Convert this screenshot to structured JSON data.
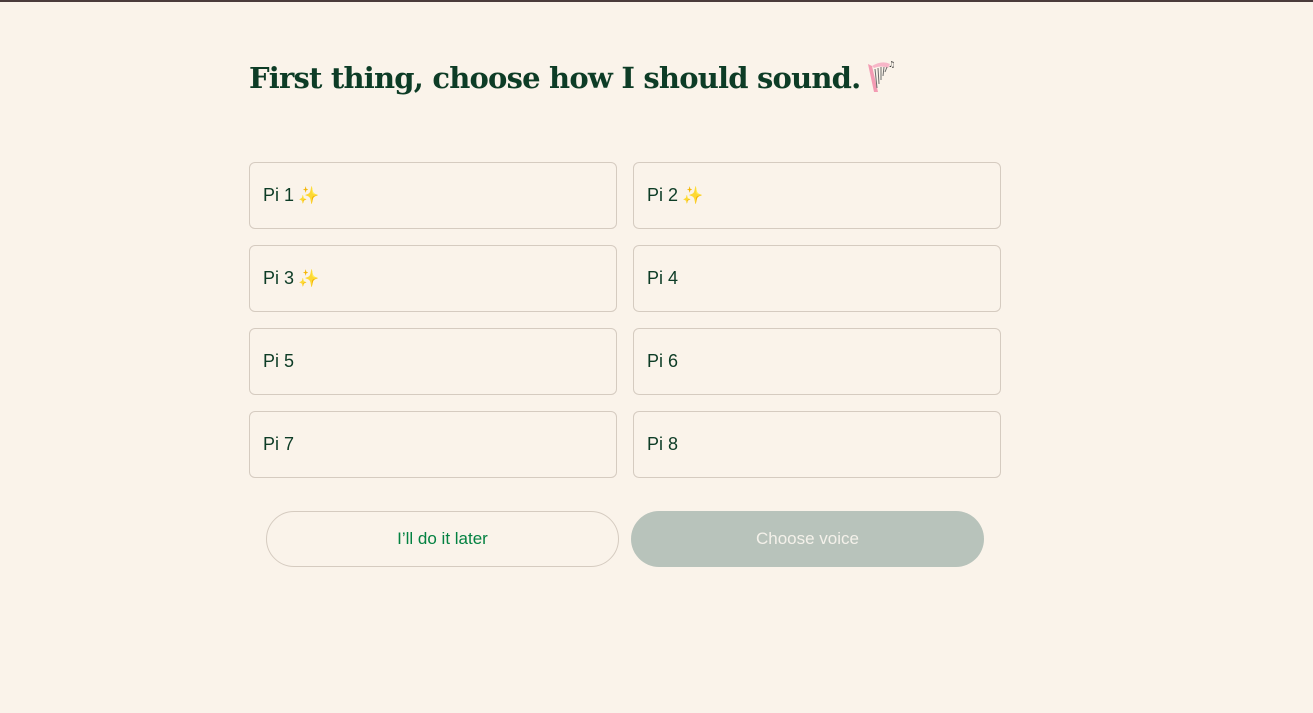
{
  "heading": {
    "text": "First thing, choose how I should sound.",
    "icon": "harp-icon"
  },
  "voices": [
    {
      "label": "Pi 1",
      "sparkle": "✨"
    },
    {
      "label": "Pi 2",
      "sparkle": "✨"
    },
    {
      "label": "Pi 3",
      "sparkle": "✨"
    },
    {
      "label": "Pi 4",
      "sparkle": ""
    },
    {
      "label": "Pi 5",
      "sparkle": ""
    },
    {
      "label": "Pi 6",
      "sparkle": ""
    },
    {
      "label": "Pi 7",
      "sparkle": ""
    },
    {
      "label": "Pi 8",
      "sparkle": ""
    }
  ],
  "actions": {
    "later_label": "I’ll do it later",
    "choose_label": "Choose voice"
  },
  "colors": {
    "background": "#faf3ea",
    "heading": "#0d3c26",
    "accent_green": "#038141",
    "disabled_button": "#b8c3bb",
    "border": "#d5cbc0"
  }
}
